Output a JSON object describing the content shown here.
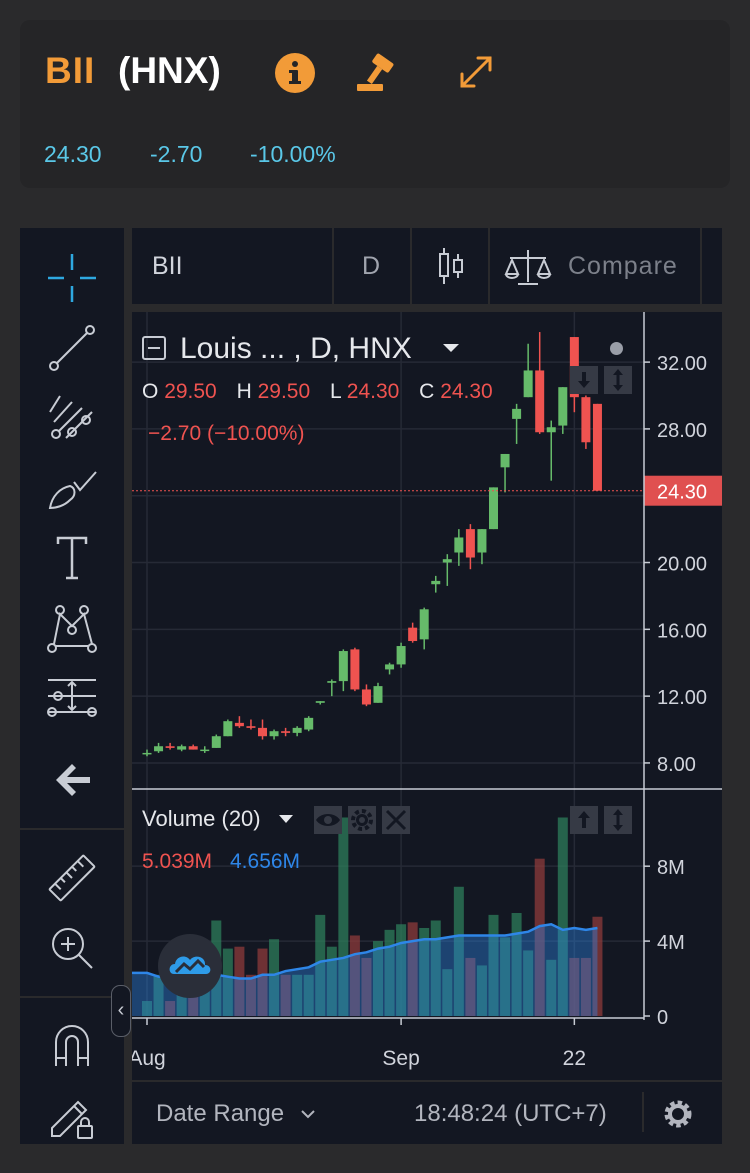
{
  "header": {
    "symbol": "BII",
    "exchange": "(HNX)",
    "price": "24.30",
    "change": "-2.70",
    "change_pct": "-10.00%",
    "icons": [
      "info-icon",
      "auction-gavel-icon",
      "expand-icon"
    ]
  },
  "toolbar": {
    "tools": [
      "crosshair-icon",
      "trend-line-icon",
      "fib-pitchfork-icon",
      "brush-icon",
      "text-icon",
      "pattern-icon",
      "measure-adjust-icon",
      "back-arrow-icon",
      "ruler-icon",
      "zoom-in-icon",
      "magnet-icon",
      "lock-pencil-icon"
    ],
    "collapse": "‹"
  },
  "topbar": {
    "symbol": "BII",
    "interval": "D",
    "compare": "Compare",
    "candle_icon": "candlestick-icon",
    "compare_icon": "scales-icon"
  },
  "legend": {
    "title": "Louis ... , D, HNX",
    "o_label": "O",
    "o": "29.50",
    "h_label": "H",
    "h": "29.50",
    "l_label": "L",
    "l": "24.30",
    "c_label": "C",
    "c": "24.30",
    "change": "−2.70 (−10.00%)",
    "last_price": "24.30"
  },
  "volume": {
    "title": "Volume (20)",
    "value": "5.039M",
    "ma": "4.656M"
  },
  "bottombar": {
    "date_range": "Date Range",
    "clock": "18:48:24 (UTC+7)"
  },
  "colors": {
    "up": "#26a69a",
    "up_candle": "#66bb6a",
    "down": "#ef5350",
    "accent": "#f29b38",
    "quote": "#5ac8e8"
  },
  "chart_data": {
    "type": "candlestick",
    "title": "Louis ... , D, HNX",
    "price_axis": [
      "8.00",
      "12.00",
      "16.00",
      "20.00",
      "24.00",
      "28.00",
      "32.00"
    ],
    "price_ylim": [
      6.5,
      35
    ],
    "volume_axis": [
      "0",
      "4M",
      "8M"
    ],
    "volume_ylim": [
      0,
      11
    ],
    "x_ticks": [
      {
        "label": "Aug",
        "index": 0
      },
      {
        "label": "Sep",
        "index": 22
      },
      {
        "label": "22",
        "index": 37
      }
    ],
    "candles": [
      {
        "o": 8.6,
        "h": 8.8,
        "l": 8.4,
        "c": 8.6
      },
      {
        "o": 8.7,
        "h": 9.2,
        "l": 8.6,
        "c": 9.0
      },
      {
        "o": 9.0,
        "h": 9.2,
        "l": 8.8,
        "c": 8.9
      },
      {
        "o": 8.8,
        "h": 9.1,
        "l": 8.7,
        "c": 9.0
      },
      {
        "o": 9.0,
        "h": 9.1,
        "l": 8.8,
        "c": 8.8
      },
      {
        "o": 8.8,
        "h": 9.0,
        "l": 8.6,
        "c": 8.8
      },
      {
        "o": 8.9,
        "h": 9.7,
        "l": 8.9,
        "c": 9.6
      },
      {
        "o": 9.6,
        "h": 10.6,
        "l": 9.6,
        "c": 10.5
      },
      {
        "o": 10.4,
        "h": 10.8,
        "l": 10.1,
        "c": 10.2
      },
      {
        "o": 10.2,
        "h": 10.6,
        "l": 10.0,
        "c": 10.1
      },
      {
        "o": 10.1,
        "h": 10.6,
        "l": 9.4,
        "c": 9.6
      },
      {
        "o": 9.6,
        "h": 10.0,
        "l": 9.4,
        "c": 9.9
      },
      {
        "o": 9.9,
        "h": 10.1,
        "l": 9.6,
        "c": 9.8
      },
      {
        "o": 9.8,
        "h": 10.2,
        "l": 9.6,
        "c": 10.1
      },
      {
        "o": 10.0,
        "h": 10.8,
        "l": 9.9,
        "c": 10.7
      },
      {
        "o": 11.6,
        "h": 11.7,
        "l": 11.5,
        "c": 11.7
      },
      {
        "o": 12.8,
        "h": 13.0,
        "l": 12.0,
        "c": 12.9
      },
      {
        "o": 12.9,
        "h": 14.8,
        "l": 12.3,
        "c": 14.7
      },
      {
        "o": 14.8,
        "h": 14.9,
        "l": 12.3,
        "c": 12.4
      },
      {
        "o": 12.4,
        "h": 12.7,
        "l": 11.4,
        "c": 11.5
      },
      {
        "o": 11.6,
        "h": 12.8,
        "l": 11.6,
        "c": 12.6
      },
      {
        "o": 13.6,
        "h": 14.0,
        "l": 13.3,
        "c": 13.9
      },
      {
        "o": 13.9,
        "h": 15.2,
        "l": 13.7,
        "c": 15.0
      },
      {
        "o": 16.1,
        "h": 16.4,
        "l": 15.2,
        "c": 15.3
      },
      {
        "o": 15.4,
        "h": 17.3,
        "l": 14.8,
        "c": 17.2
      },
      {
        "o": 18.7,
        "h": 19.2,
        "l": 18.2,
        "c": 18.9
      },
      {
        "o": 20.0,
        "h": 20.5,
        "l": 18.6,
        "c": 20.2
      },
      {
        "o": 20.6,
        "h": 22.0,
        "l": 19.8,
        "c": 21.5
      },
      {
        "o": 22.0,
        "h": 22.3,
        "l": 19.6,
        "c": 20.3
      },
      {
        "o": 20.6,
        "h": 22.0,
        "l": 19.9,
        "c": 22.0
      },
      {
        "o": 22.0,
        "h": 24.5,
        "l": 22.0,
        "c": 24.5
      },
      {
        "o": 25.7,
        "h": 26.5,
        "l": 24.2,
        "c": 26.5
      },
      {
        "o": 28.6,
        "h": 29.5,
        "l": 27.1,
        "c": 29.2
      },
      {
        "o": 29.9,
        "h": 33.1,
        "l": 29.9,
        "c": 31.5
      },
      {
        "o": 31.5,
        "h": 33.8,
        "l": 27.7,
        "c": 27.8
      },
      {
        "o": 27.8,
        "h": 28.5,
        "l": 24.9,
        "c": 28.1
      },
      {
        "o": 28.2,
        "h": 30.5,
        "l": 27.7,
        "c": 30.5
      },
      {
        "o": 33.5,
        "h": 33.5,
        "l": 29.0,
        "c": 29.9
      },
      {
        "o": 29.9,
        "h": 30.0,
        "l": 26.8,
        "c": 27.2
      },
      {
        "o": 29.5,
        "h": 29.5,
        "l": 24.3,
        "c": 24.3
      }
    ],
    "volume": [
      0.8,
      2.2,
      0.8,
      2.3,
      3.5,
      2.6,
      5.1,
      3.6,
      3.7,
      2.2,
      3.6,
      4.1,
      2.2,
      2.2,
      2.2,
      5.4,
      3.7,
      10.6,
      4.3,
      3.1,
      4.0,
      4.6,
      4.9,
      5.0,
      4.7,
      5.1,
      2.5,
      6.9,
      3.1,
      2.7,
      5.4,
      4.2,
      5.5,
      3.5,
      8.4,
      3.0,
      10.6,
      3.1,
      3.1,
      5.3
    ],
    "volume_ma": [
      2.3,
      2.1,
      2.1,
      2.0,
      2.1,
      2.2,
      2.2,
      2.1,
      2.0,
      2.0,
      2.2,
      2.2,
      2.4,
      2.5,
      2.6,
      2.9,
      3.0,
      3.1,
      3.3,
      3.4,
      3.6,
      3.7,
      3.9,
      4.0,
      4.1,
      4.1,
      4.2,
      4.3,
      4.3,
      4.3,
      4.3,
      4.3,
      4.4,
      4.5,
      4.8,
      4.9,
      4.6,
      4.7,
      4.6,
      4.7
    ]
  }
}
